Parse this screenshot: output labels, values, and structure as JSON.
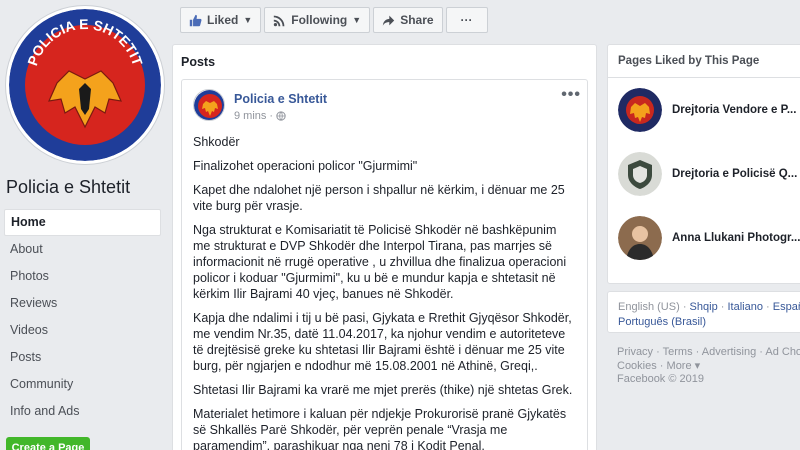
{
  "page": {
    "name": "Policia e Shtetit",
    "profile_badge_text": "POLICIA E SHTETIT"
  },
  "colors": {
    "badge_blue": "#1f3d99",
    "badge_red": "#d6251e",
    "eagle": "#c8281e",
    "link": "#385898",
    "create_green": "#42b72a"
  },
  "left_nav": {
    "items": [
      {
        "label": "Home",
        "active": true
      },
      {
        "label": "About"
      },
      {
        "label": "Photos"
      },
      {
        "label": "Reviews"
      },
      {
        "label": "Videos"
      },
      {
        "label": "Posts"
      },
      {
        "label": "Community"
      },
      {
        "label": "Info and Ads"
      }
    ],
    "create_page_label": "Create a Page"
  },
  "action_bar": {
    "liked": {
      "label": "Liked",
      "icon": "thumbs-up-icon"
    },
    "following": {
      "label": "Following",
      "icon": "rss-icon"
    },
    "share": {
      "label": "Share",
      "icon": "share-arrow-icon"
    },
    "more": {
      "label": "···"
    }
  },
  "posts": {
    "heading": "Posts",
    "post": {
      "author": "Policia e Shtetit",
      "time": "9 mins",
      "privacy_icon": "globe-icon",
      "menu_label": "•••",
      "paragraphs": [
        "Shkodër",
        "Finalizohet operacioni policor \"Gjurmimi\"",
        "Kapet dhe ndalohet një person i shpallur në kërkim, i dënuar me 25 vite burg për vrasje.",
        "Nga strukturat e Komisariatit të Policisë Shkodër në bashkëpunim me strukturat e DVP Shkodër dhe Interpol Tirana, pas marrjes së informacionit në rrugë operative , u zhvillua dhe finalizua operacioni policor i koduar \"Gjurmimi\", ku u bë e mundur kapja e shtetasit në kërkim Ilir Bajrami 40 vjeç, banues në Shkodër.",
        "Kapja dhe ndalimi i tij u bë pasi, Gjykata e Rrethit Gjyqësor Shkodër, me vendim Nr.35, datë 11.04.2017, ka njohur vendim e autoriteteve të drejtësisë greke ku shtetasi Ilir Bajrami është i dënuar me 25 vite burg, për ngjarjen e ndodhur më 15.08.2001 në Athinë, Greqi,.",
        "Shtetasi Ilir Bajrami ka vrarë me mjet prerës (thike) një shtetas Grek.",
        "Materialet hetimore i kaluan për ndjekje Prokurorisë pranë Gjykatës së Shkallës Parë Shkodër, për veprën penale “Vrasja me paramendim”, parashikuar nga neni 78 i Kodit Penal."
      ]
    }
  },
  "right": {
    "liked_heading": "Pages Liked by This Page",
    "liked_pages": [
      {
        "name": "Drejtoria Vendore e P..."
      },
      {
        "name": "Drejtoria e Policisë Q..."
      },
      {
        "name": "Anna Llukani Photogr..."
      }
    ],
    "languages": {
      "current": "English (US)",
      "options": [
        "Shqip",
        "Italiano",
        "Español",
        "Português (Brasil)"
      ]
    },
    "footer": {
      "line1": [
        "Privacy",
        "Terms",
        "Advertising",
        "Ad Choices"
      ],
      "line2": [
        "Cookies",
        "More ▾"
      ],
      "copyright": "Facebook © 2019"
    }
  }
}
